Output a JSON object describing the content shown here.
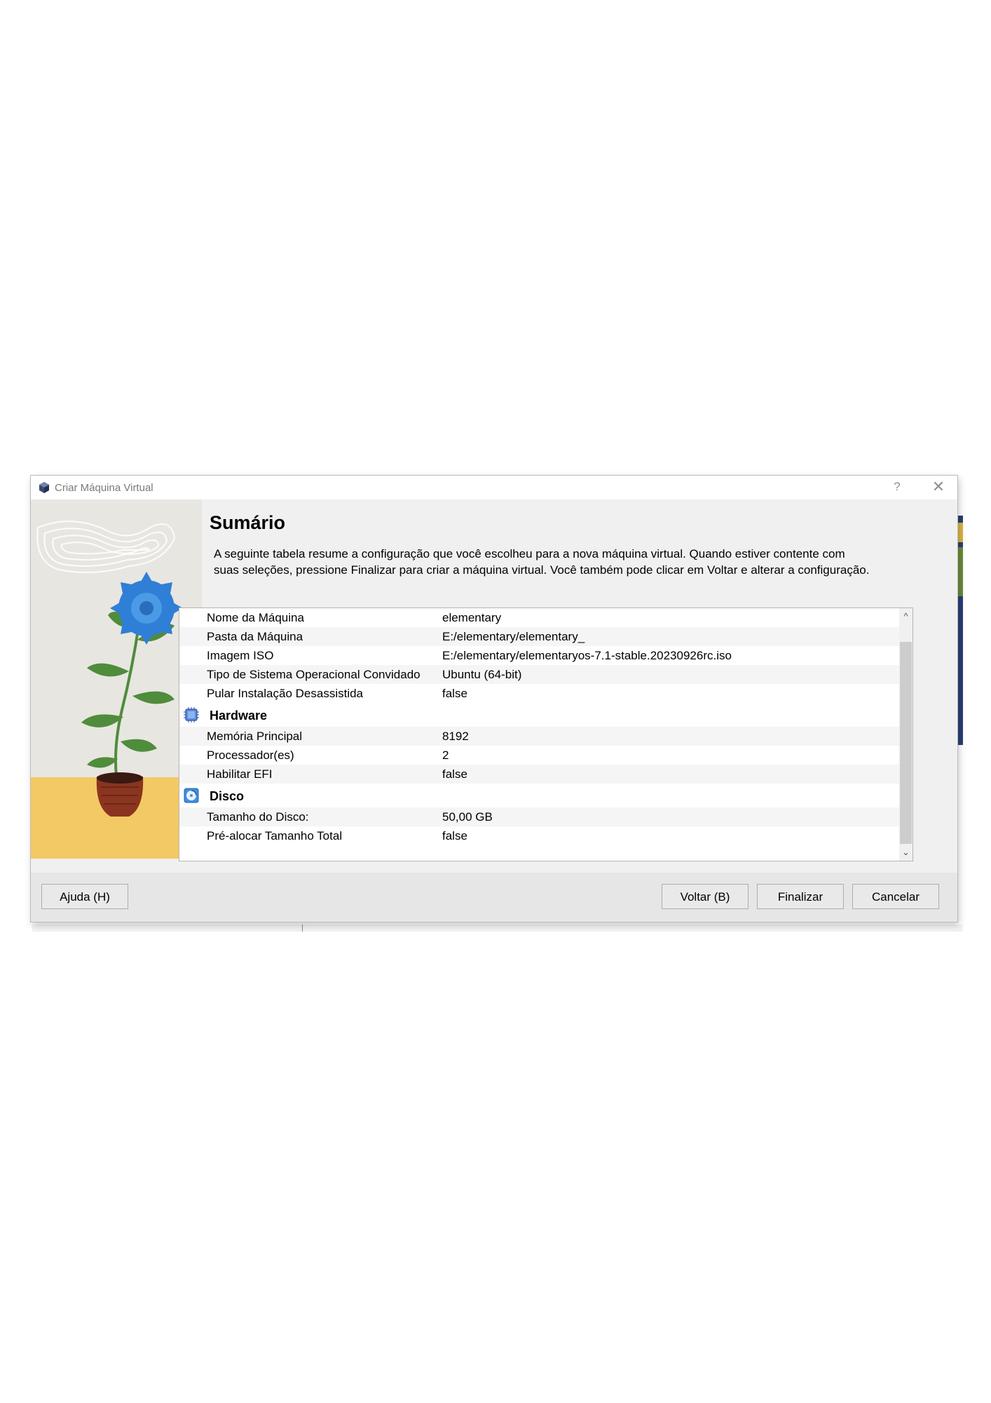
{
  "window": {
    "title": "Criar Máquina Virtual",
    "help_glyph": "?",
    "close_glyph": "✕"
  },
  "page": {
    "heading": "Sumário",
    "description": "A seguinte tabela resume a configuração que você escolheu para a nova máquina virtual. Quando estiver contente com suas seleções, pressione Finalizar para criar a máquina virtual. Você também pode clicar em Voltar e alterar a configuração."
  },
  "summary": {
    "general": [
      {
        "key": "Nome da Máquina",
        "value": "elementary"
      },
      {
        "key": "Pasta da Máquina",
        "value": "E:/elementary/elementary_"
      },
      {
        "key": "Imagem ISO",
        "value": "E:/elementary/elementaryos-7.1-stable.20230926rc.iso"
      },
      {
        "key": "Tipo de Sistema Operacional Convidado",
        "value": "Ubuntu (64-bit)"
      },
      {
        "key": "Pular Instalação Desassistida",
        "value": "false"
      }
    ],
    "hardware": {
      "title": "Hardware",
      "icon": "chip-icon",
      "rows": [
        {
          "key": "Memória Principal",
          "value": "8192"
        },
        {
          "key": "Processador(es)",
          "value": "2"
        },
        {
          "key": "Habilitar EFI",
          "value": "false"
        }
      ]
    },
    "disk": {
      "title": "Disco",
      "icon": "disk-icon",
      "rows": [
        {
          "key": "Tamanho do Disco:",
          "value": "50,00 GB"
        },
        {
          "key": "Pré-alocar Tamanho Total",
          "value": "false"
        }
      ]
    }
  },
  "scrollbar": {
    "up_glyph": "^",
    "down_glyph": "⌄"
  },
  "buttons": {
    "help": "Ajuda (H)",
    "back": "Voltar (B)",
    "finish": "Finalizar",
    "cancel": "Cancelar"
  },
  "colors": {
    "flower": "#2f7fd6",
    "leaf": "#4f8c3c",
    "pot": "#8b3420",
    "ground": "#f2c964"
  }
}
